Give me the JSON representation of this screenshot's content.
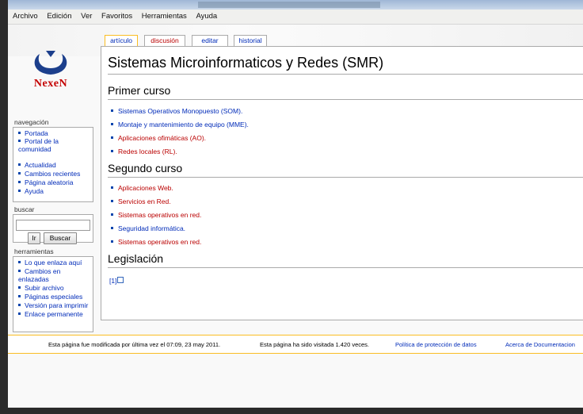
{
  "menu": [
    "Archivo",
    "Edición",
    "Ver",
    "Favoritos",
    "Herramientas",
    "Ayuda"
  ],
  "logo": {
    "text": "NexeN",
    "icon": "site-logo",
    "color": "#c40000"
  },
  "tabs": [
    {
      "label": "artículo",
      "selected": true,
      "new": false
    },
    {
      "label": "discusión",
      "selected": false,
      "new": true
    },
    {
      "label": "editar",
      "selected": false,
      "new": false
    },
    {
      "label": "historial",
      "selected": false,
      "new": false
    }
  ],
  "article": {
    "title": "Sistemas Microinformaticos y Redes (SMR)",
    "sections": [
      {
        "heading": "Primer curso",
        "items": [
          {
            "text": "Sistemas Operativos Monopuesto (SOM).",
            "link": "exists"
          },
          {
            "text": "Montaje y mantenimiento de equipo (MME).",
            "link": "exists"
          },
          {
            "text": "Aplicaciones ofimáticas (AO).",
            "link": "new"
          },
          {
            "text": "Redes locales (RL).",
            "link": "new"
          }
        ]
      },
      {
        "heading": "Segundo curso",
        "items": [
          {
            "text": "Aplicaciones Web.",
            "link": "new"
          },
          {
            "text": "Servicios en Red.",
            "link": "new"
          },
          {
            "text": "Sistemas operativos en red.",
            "link": "new"
          },
          {
            "text": "Seguridad informática.",
            "link": "exists"
          },
          {
            "text": "Sistemas operativos en red.",
            "link": "new"
          }
        ]
      },
      {
        "heading": "Legislación",
        "external_link": "[1]"
      }
    ]
  },
  "sidebar": {
    "navigation": {
      "heading": "navegación",
      "items": [
        "Portada",
        "Portal de la comunidad",
        "Actualidad",
        "Cambios recientes",
        "Página aleatoria",
        "Ayuda"
      ]
    },
    "search": {
      "heading": "buscar",
      "value": "",
      "go_label": "Ir",
      "search_label": "Buscar"
    },
    "tools": {
      "heading": "herramientas",
      "items": [
        "Lo que enlaza aquí",
        "Cambios en enlazadas",
        "Subir archivo",
        "Páginas especiales",
        "Versión para imprimir",
        "Enlace permanente"
      ]
    }
  },
  "footer": {
    "lastmod": "Esta página fue modificada por última vez el 07:09, 23 may 2011.",
    "viewcount": "Esta página ha sido visitada 1.420 veces.",
    "privacy": "Política de protección de datos",
    "about": "Acerca de Documentacion"
  },
  "colors": {
    "link": "#002bb8",
    "new_link": "#ba0000",
    "tab_selected_border": "#fabd23"
  }
}
